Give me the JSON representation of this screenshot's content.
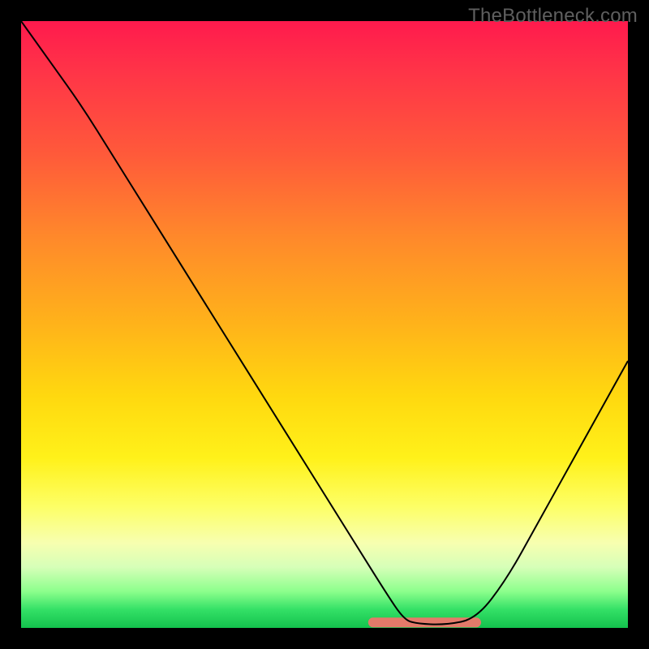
{
  "watermark": {
    "text": "TheBottleneck.com"
  },
  "colors": {
    "curve": "#000000",
    "highlight": "#e47a6a",
    "frame": "#000000",
    "gradient_top": "#ff1a4d",
    "gradient_mid": "#ffd90f",
    "gradient_bottom": "#14c24d"
  },
  "chart_data": {
    "type": "line",
    "title": "",
    "xlabel": "",
    "ylabel": "",
    "xlim": [
      0,
      100
    ],
    "ylim": [
      0,
      100
    ],
    "grid": false,
    "legend": false,
    "notes": "V-shaped bottleneck curve overlaid on a red→yellow→green vertical gradient. Axes are unlabeled; values are estimated as percentages of the plot area.",
    "series": [
      {
        "name": "bottleneck-curve",
        "x": [
          0,
          5,
          10,
          15,
          20,
          25,
          30,
          35,
          40,
          45,
          50,
          55,
          60,
          63,
          65,
          70,
          75,
          80,
          85,
          90,
          95,
          100
        ],
        "y": [
          100,
          93,
          86,
          78,
          70,
          62,
          54,
          46,
          38,
          30,
          22,
          14,
          6,
          1.5,
          0.7,
          0.5,
          1.5,
          8,
          17,
          26,
          35,
          44
        ]
      }
    ],
    "highlight_segment": {
      "name": "sweet-spot",
      "x_range": [
        58,
        75
      ],
      "y_approx": 0.9,
      "description": "Flat bottom of the curve marked by a thick salmon stroke"
    }
  }
}
